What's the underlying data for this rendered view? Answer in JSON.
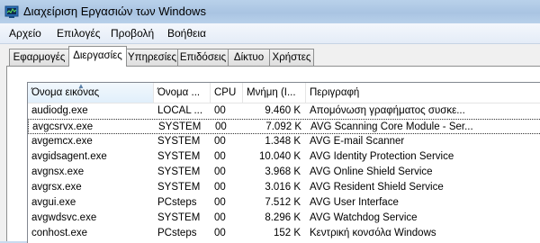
{
  "window": {
    "title": "Διαχείριση Εργασιών των Windows",
    "icon": "task-manager-icon"
  },
  "menu": [
    "Αρχείο",
    "Επιλογές",
    "Προβολή",
    "Βοήθεια"
  ],
  "tabs": [
    {
      "label": "Εφαρμογές",
      "active": false
    },
    {
      "label": "Διεργασίες",
      "active": true
    },
    {
      "label": "Υπηρεσίες",
      "active": false
    },
    {
      "label": "Επιδόσεις",
      "active": false
    },
    {
      "label": "Δίκτυο",
      "active": false
    },
    {
      "label": "Χρήστες",
      "active": false
    }
  ],
  "table": {
    "columns": [
      "Όνομα εικόνας",
      "Όνομα ...",
      "CPU",
      "Μνήμη (I...",
      "Περιγραφή"
    ],
    "sorted_column": 0,
    "rows": [
      [
        "audiodg.exe",
        "LOCAL ...",
        "00",
        "9.460 K",
        "Απομόνωση γραφήματος συσκε..."
      ],
      [
        "avgcsrvx.exe",
        "SYSTEM",
        "00",
        "7.092 K",
        "AVG Scanning Core Module - Ser..."
      ],
      [
        "avgemcx.exe",
        "SYSTEM",
        "00",
        "1.348 K",
        "AVG E-mail Scanner"
      ],
      [
        "avgidsagent.exe",
        "SYSTEM",
        "00",
        "10.040 K",
        "AVG Identity Protection Service"
      ],
      [
        "avgnsx.exe",
        "SYSTEM",
        "00",
        "3.968 K",
        "AVG Online Shield Service"
      ],
      [
        "avgrsx.exe",
        "SYSTEM",
        "00",
        "3.016 K",
        "AVG Resident Shield Service"
      ],
      [
        "avgui.exe",
        "PCsteps",
        "00",
        "7.512 K",
        "AVG User Interface"
      ],
      [
        "avgwdsvc.exe",
        "SYSTEM",
        "00",
        "8.296 K",
        "AVG Watchdog Service"
      ],
      [
        "conhost.exe",
        "PCsteps",
        "00",
        "152 K",
        "Κεντρική κονσόλα Windows"
      ]
    ],
    "selected_row": 1
  }
}
